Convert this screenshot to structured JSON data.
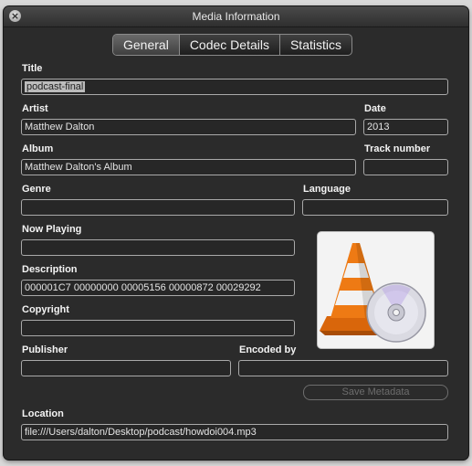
{
  "window": {
    "title": "Media Information",
    "close_glyph": "×"
  },
  "tabs": [
    {
      "label": "General",
      "active": true
    },
    {
      "label": "Codec Details",
      "active": false
    },
    {
      "label": "Statistics",
      "active": false
    }
  ],
  "fields": {
    "title": {
      "label": "Title",
      "value": "podcast-final"
    },
    "artist": {
      "label": "Artist",
      "value": "Matthew Dalton"
    },
    "date": {
      "label": "Date",
      "value": "2013"
    },
    "album": {
      "label": "Album",
      "value": "Matthew Dalton's Album"
    },
    "track_number": {
      "label": "Track number",
      "value": ""
    },
    "genre": {
      "label": "Genre",
      "value": ""
    },
    "language": {
      "label": "Language",
      "value": ""
    },
    "now_playing": {
      "label": "Now Playing",
      "value": ""
    },
    "description": {
      "label": "Description",
      "value": " 000001C7 00000000 00005156 00000872 00029292"
    },
    "copyright": {
      "label": "Copyright",
      "value": ""
    },
    "publisher": {
      "label": "Publisher",
      "value": ""
    },
    "encoded_by": {
      "label": "Encoded by",
      "value": ""
    },
    "location": {
      "label": "Location",
      "value": "file:///Users/dalton/Desktop/podcast/howdoi004.mp3"
    }
  },
  "artwork": {
    "icon": "vlc-cone-with-disc-icon"
  },
  "save_button": {
    "label": "Save Metadata",
    "enabled": false
  },
  "colors": {
    "window_bg": "#2b2b2b",
    "cone_orange": "#ee7a14",
    "cone_white": "#f2f2f2"
  }
}
